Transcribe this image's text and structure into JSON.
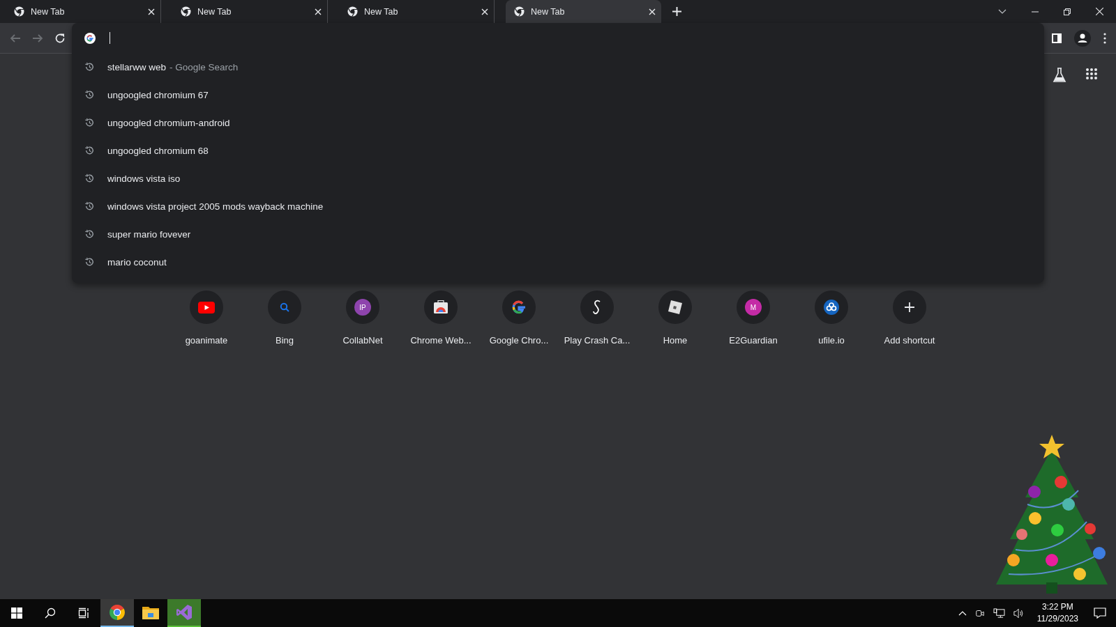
{
  "tabs": [
    {
      "title": "New Tab",
      "selected": false
    },
    {
      "title": "New Tab",
      "selected": false
    },
    {
      "title": "New Tab",
      "selected": false
    },
    {
      "title": "New Tab",
      "selected": true
    }
  ],
  "suggestions": [
    {
      "text": "stellarww web",
      "suffix": "- Google Search"
    },
    {
      "text": "ungoogled chromium 67"
    },
    {
      "text": "ungoogled chromium-android"
    },
    {
      "text": "ungoogled chromium 68"
    },
    {
      "text": "windows vista iso"
    },
    {
      "text": "windows vista project 2005 mods wayback machine"
    },
    {
      "text": "super mario fovever"
    },
    {
      "text": "mario coconut"
    }
  ],
  "shortcuts": [
    {
      "label": "goanimate",
      "kind": "youtube"
    },
    {
      "label": "Bing",
      "kind": "search"
    },
    {
      "label": "CollabNet",
      "kind": "monogram",
      "monogram": "IP",
      "color": "#8e44ad"
    },
    {
      "label": "Chrome Web...",
      "kind": "store"
    },
    {
      "label": "Google Chro...",
      "kind": "google"
    },
    {
      "label": "Play Crash Ca...",
      "kind": "script"
    },
    {
      "label": "Home",
      "kind": "cube"
    },
    {
      "label": "E2Guardian",
      "kind": "monogram",
      "monogram": "M",
      "color": "#c42ba6"
    },
    {
      "label": "ufile.io",
      "kind": "cloud"
    },
    {
      "label": "Add shortcut",
      "kind": "add"
    }
  ],
  "taskbar": {
    "apps": [
      {
        "kind": "chrome",
        "selected": true
      },
      {
        "kind": "folder",
        "selected": false
      },
      {
        "kind": "studio",
        "selected": false,
        "flashing": true
      }
    ],
    "time": "3:22 PM",
    "date": "11/29/2023"
  }
}
